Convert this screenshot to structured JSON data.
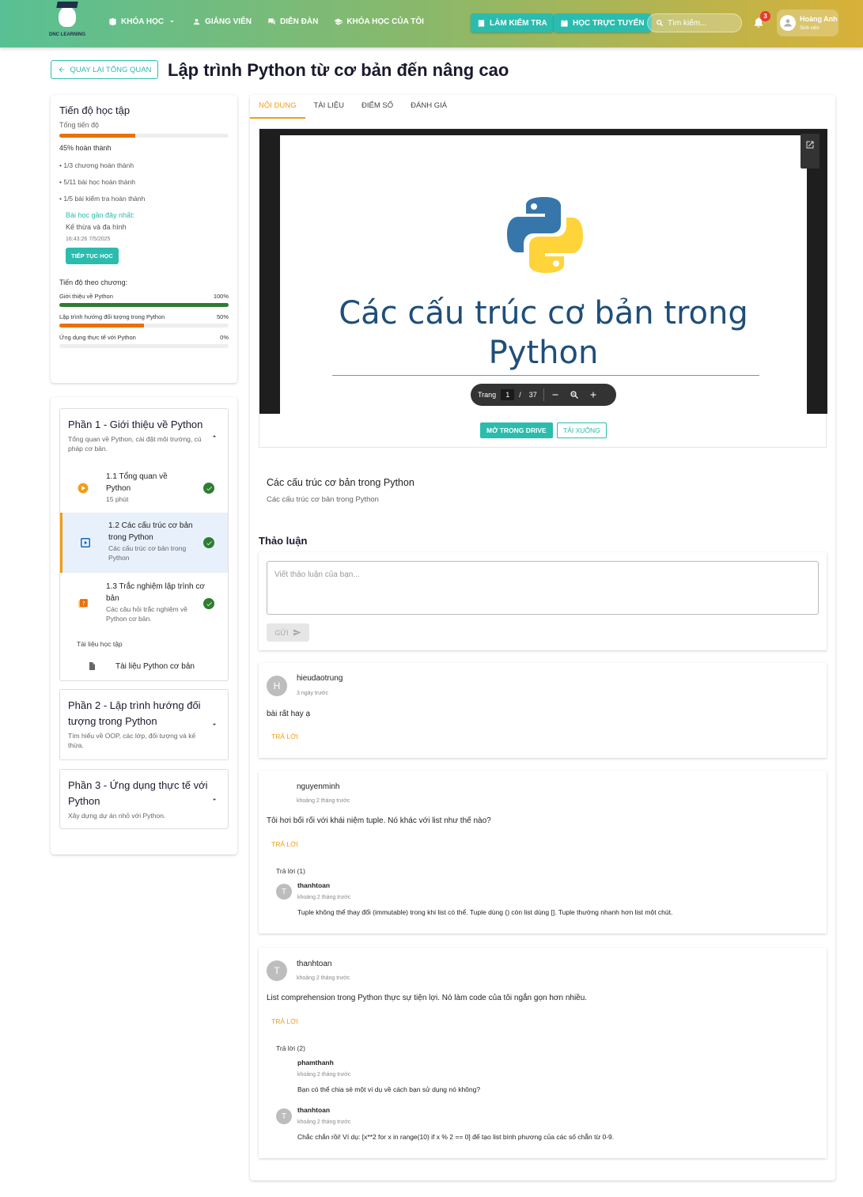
{
  "header": {
    "logo_text": "DNC LEARNING",
    "nav": [
      {
        "label": "KHÓA HỌC",
        "icon": "book-icon"
      },
      {
        "label": "GIẢNG VIÊN",
        "icon": "person-icon"
      },
      {
        "label": "DIỄN ĐÀN",
        "icon": "forum-icon"
      },
      {
        "label": "KHÓA HỌC CỦA TÔI",
        "icon": "graduation-cap-icon"
      }
    ],
    "quiz_button": "LÀM KIỂM TRA",
    "online_button": "HỌC TRỰC TUYẾN",
    "search_placeholder": "Tìm kiếm...",
    "notification_count": "3",
    "user_name": "Hoàng Anh",
    "user_role": "Sinh viên"
  },
  "page": {
    "back_label": "QUAY LẠI TỔNG QUAN",
    "title": "Lập trình Python từ cơ bản đến nâng cao"
  },
  "progress": {
    "title": "Tiến độ học tập",
    "subtitle": "Tổng tiến độ",
    "percent_value": 45,
    "percent_label": "45% hoàn thành",
    "stats": [
      "• 1/3 chương hoàn thành",
      "• 5/11 bài học hoàn thành",
      "• 1/5 bài kiểm tra hoàn thành"
    ],
    "recent_label": "Bài học gần đây nhất:",
    "recent_lesson": "Kế thừa và đa hình",
    "recent_time": "16:43:26 7/5/2025",
    "continue_label": "TIẾP TỤC HỌC",
    "chapter_title": "Tiến độ theo chương:",
    "chapters": [
      {
        "name": "Giới thiệu về Python",
        "percent": "100%",
        "value": 100
      },
      {
        "name": "Lập trình hướng đối tượng trong Python",
        "percent": "50%",
        "value": 50
      },
      {
        "name": "Ứng dụng thực tế với Python",
        "percent": "0%",
        "value": 0
      }
    ]
  },
  "sections": [
    {
      "title": "Phần 1 - Giới thiệu về Python",
      "desc": "Tổng quan về Python, cài đặt môi trường, cú pháp cơ bản.",
      "lessons": [
        {
          "title": "1.1 Tổng quan về Python",
          "sub": "15 phút"
        },
        {
          "title": "1.2 Các cấu trúc cơ bản trong Python",
          "sub": "Các cấu trúc cơ bản trong Python"
        },
        {
          "title": "1.3 Trắc nghiệm lập trình cơ bản",
          "sub": "Các câu hỏi trắc nghiệm về Python cơ bản."
        }
      ],
      "materials_label": "Tài liệu học tập",
      "material": "Tài liệu Python cơ bản"
    },
    {
      "title": "Phần 2 - Lập trình hướng đối tượng trong Python",
      "desc": "Tìm hiểu về OOP, các lớp, đối tượng và kế thừa."
    },
    {
      "title": "Phần 3 - Ứng dụng thực tế với Python",
      "desc": "Xây dựng dự án nhỏ với Python."
    }
  ],
  "tabs": [
    "NỘI DUNG",
    "TÀI LIỆU",
    "ĐIỂM SỐ",
    "ĐÁNH GIÁ"
  ],
  "viewer": {
    "slide_title": "Các cấu trúc cơ bản trong Python",
    "page_label": "Trang",
    "page_current": "1",
    "page_separator": "/",
    "page_total": "37",
    "open_drive": "MỞ TRONG DRIVE",
    "download": "TẢI XUỐNG"
  },
  "lesson": {
    "title": "Các cấu trúc cơ bản trong Python",
    "desc": "Các cấu trúc cơ bản trong Python"
  },
  "discussion": {
    "title": "Thảo luận",
    "placeholder": "Viết thảo luận của bạn...",
    "send_label": "GỬI",
    "comments": [
      {
        "initial": "H",
        "author": "hieudaotrung",
        "time": "3 ngày trước",
        "text": "bài rất hay ạ",
        "reply_label": "TRẢ LỜI"
      },
      {
        "author": "nguyenminh",
        "time": "khoảng 2 tháng trước",
        "text": "Tôi hơi bối rối với khái niệm tuple. Nó khác với list như thế nào?",
        "reply_label": "TRẢ LỜI",
        "replies_label": "Trả lời (1)",
        "replies": [
          {
            "initial": "T",
            "author": "thanhtoan",
            "time": "khoảng 2 tháng trước",
            "text": "Tuple không thể thay đổi (immutable) trong khi list có thể. Tuple dùng () còn list dùng []. Tuple thường nhanh hơn list một chút."
          }
        ]
      },
      {
        "initial": "T",
        "author": "thanhtoan",
        "time": "khoảng 2 tháng trước",
        "text": "List comprehension trong Python thực sự tiện lợi. Nó làm code của tôi ngắn gọn hơn nhiều.",
        "reply_label": "TRẢ LỜI",
        "replies_label": "Trả lời (2)",
        "replies": [
          {
            "author": "phamthanh",
            "time": "khoảng 2 tháng trước",
            "text": "Bạn có thể chia sẻ một ví dụ về cách bạn sử dụng nó không?"
          },
          {
            "initial": "T",
            "author": "thanhtoan",
            "time": "khoảng 2 tháng trước",
            "text": "Chắc chắn rồi! Ví dụ: [x**2 for x in range(10) if x % 2 == 0] để tạo list bình phương của các số chẵn từ 0-9."
          }
        ]
      }
    ]
  },
  "colors": {
    "accent": "#2bbcae",
    "orange": "#f39c12",
    "progress": "#e8710a",
    "complete": "#2e7d32"
  }
}
